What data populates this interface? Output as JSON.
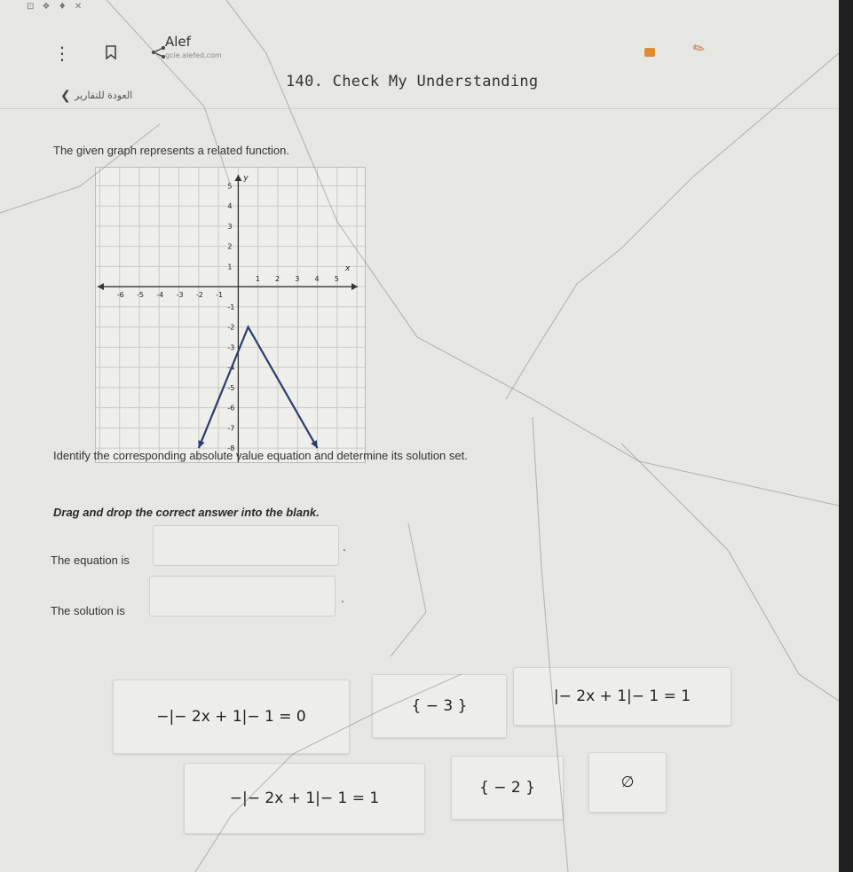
{
  "status_bar": {
    "icons_text": "⊡ ❖ ♦ ✕"
  },
  "app": {
    "title": "Alef",
    "url": "gcie.alefed.com"
  },
  "nav": {
    "back_label": "العودة للتقارير"
  },
  "header": {
    "title": "140. Check My Understanding"
  },
  "question": {
    "intro": "The given graph represents a related function.",
    "identify": "Identify the corresponding absolute value equation and determine its solution set.",
    "instruction": "Drag and drop the correct answer into the blank.",
    "equation_label": "The equation is",
    "solution_label": "The solution is",
    "period": "."
  },
  "graph": {
    "x_label": "x",
    "y_label": "y",
    "x_ticks": [
      "-6",
      "-5",
      "-4",
      "-3",
      "-2",
      "-1",
      "1",
      "2",
      "3",
      "4",
      "5"
    ],
    "y_ticks": [
      "5",
      "4",
      "3",
      "2",
      "1",
      "-1",
      "-2",
      "-3",
      "-4",
      "-5",
      "-6",
      "-7",
      "-8"
    ]
  },
  "chart_data": {
    "type": "line",
    "x_range": [
      -6,
      5
    ],
    "y_range": [
      -8,
      5
    ],
    "grid": true,
    "xlabel": "x",
    "ylabel": "y",
    "series": [
      {
        "x": [
          -2,
          0.5,
          4
        ],
        "y": [
          -8,
          -2,
          -8
        ]
      }
    ]
  },
  "answer_tiles": [
    "−|− 2x + 1|− 1 = 0",
    "{ − 3 }",
    "|− 2x + 1|− 1 = 1",
    "−|− 2x + 1|− 1 = 1",
    "{ − 2 }",
    "∅"
  ]
}
